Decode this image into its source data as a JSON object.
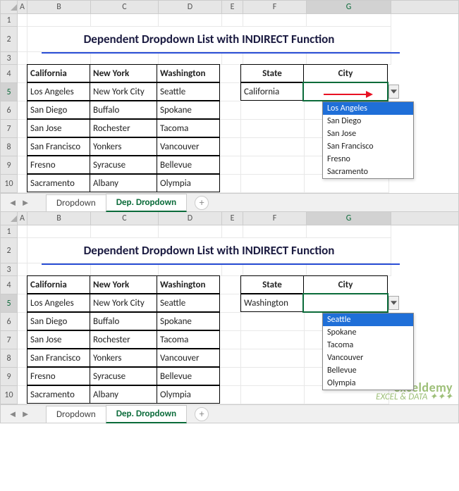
{
  "title": "Dependent Dropdown List with INDIRECT Function",
  "columns": [
    "A",
    "B",
    "C",
    "D",
    "E",
    "F",
    "G"
  ],
  "visible_rows": [
    1,
    2,
    3,
    4,
    5,
    6,
    7,
    8,
    9,
    10
  ],
  "state_header": "State",
  "city_header": "City",
  "lookup_table": {
    "headers": [
      "California",
      "New York",
      "Washington"
    ],
    "rows": [
      [
        "Los Angeles",
        "New York City",
        "Seattle"
      ],
      [
        "San Diego",
        "Buffalo",
        "Spokane"
      ],
      [
        "San Jose",
        "Rochester",
        "Tacoma"
      ],
      [
        "San Francisco",
        "Yonkers",
        "Vancouver"
      ],
      [
        "Fresno",
        "Syracuse",
        "Bellevue"
      ],
      [
        "Sacramento",
        "Albany",
        "Olympia"
      ]
    ]
  },
  "tabs": {
    "inactive": "Dropdown",
    "active": "Dep. Dropdown"
  },
  "panels": [
    {
      "selected_state": "California",
      "selected_city": "",
      "show_arrow": true,
      "dropdown_options": [
        "Los Angeles",
        "San Diego",
        "San Jose",
        "San Francisco",
        "Fresno",
        "Sacramento"
      ],
      "dropdown_highlight_index": 0
    },
    {
      "selected_state": "Washington",
      "selected_city": "",
      "show_arrow": false,
      "dropdown_options": [
        "Seattle",
        "Spokane",
        "Tacoma",
        "Vancouver",
        "Bellevue",
        "Olympia"
      ],
      "dropdown_highlight_index": 0
    }
  ],
  "watermark": {
    "line1": "exceldemy",
    "line2": "EXCEL & DATA ✦✦✦"
  },
  "chart_data": {
    "type": "table",
    "note": "Spreadsheet lookup table mapping state → city list",
    "series": [
      {
        "name": "California",
        "values": [
          "Los Angeles",
          "San Diego",
          "San Jose",
          "San Francisco",
          "Fresno",
          "Sacramento"
        ]
      },
      {
        "name": "New York",
        "values": [
          "New York City",
          "Buffalo",
          "Rochester",
          "Yonkers",
          "Syracuse",
          "Albany"
        ]
      },
      {
        "name": "Washington",
        "values": [
          "Seattle",
          "Spokane",
          "Tacoma",
          "Vancouver",
          "Bellevue",
          "Olympia"
        ]
      }
    ]
  }
}
